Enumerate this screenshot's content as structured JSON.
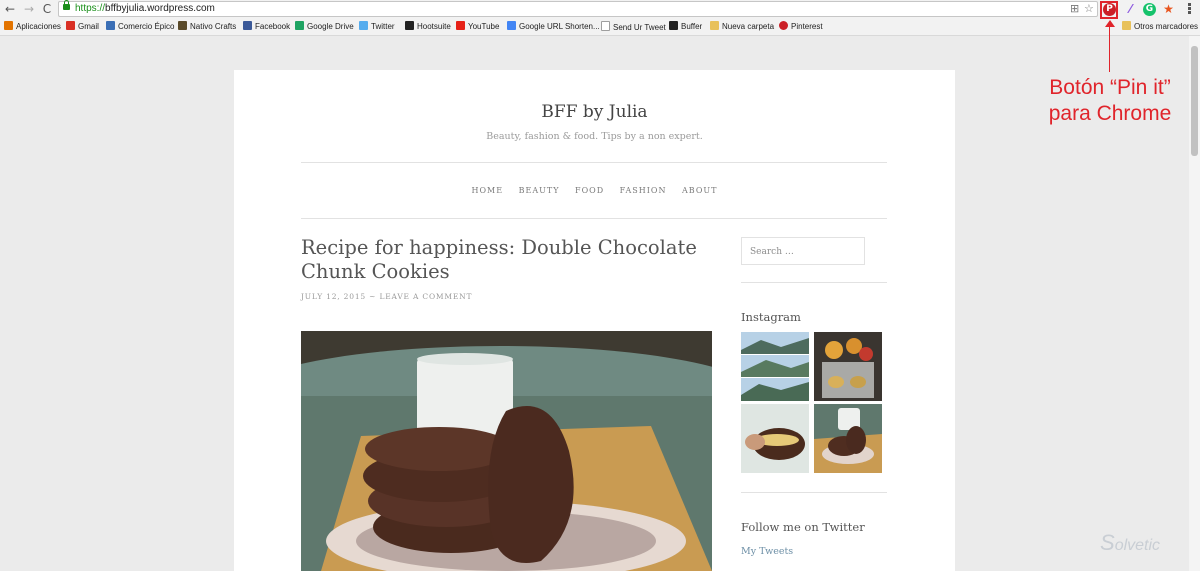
{
  "browser": {
    "url_scheme": "https://",
    "url_host": "bffbyjulia.wordpress.com"
  },
  "bookmarks": [
    {
      "label": "Aplicaciones",
      "icon": "apps-grid-icon",
      "color": "#e37400"
    },
    {
      "label": "Gmail",
      "icon": "gmail-icon",
      "color": "#d93025"
    },
    {
      "label": "Comercio Épico",
      "icon": "comercio-icon",
      "color": "#3b6fb6"
    },
    {
      "label": "Nativo Crafts",
      "icon": "nativo-icon",
      "color": "#5a4a2a"
    },
    {
      "label": "Facebook",
      "icon": "facebook-icon",
      "color": "#3b5998"
    },
    {
      "label": "Google Drive",
      "icon": "drive-icon",
      "color": "#1fa463"
    },
    {
      "label": "Twitter",
      "icon": "twitter-icon",
      "color": "#55acee"
    },
    {
      "label": "Hootsuite",
      "icon": "hootsuite-icon",
      "color": "#222222"
    },
    {
      "label": "YouTube",
      "icon": "youtube-icon",
      "color": "#e62117"
    },
    {
      "label": "Google URL Shorten...",
      "icon": "google-icon",
      "color": "#4285f4"
    },
    {
      "label": "Send Ur Tweet",
      "icon": "page-icon",
      "color": "#9e9e9e"
    },
    {
      "label": "Buffer",
      "icon": "buffer-icon",
      "color": "#222222"
    },
    {
      "label": "Nueva carpeta",
      "icon": "folder-icon",
      "color": "#e8c15b"
    },
    {
      "label": "Pinterest",
      "icon": "pinterest-icon",
      "color": "#cb2027"
    }
  ],
  "other_bookmarks": "Otros marcadores",
  "site": {
    "title": "BFF by Julia",
    "tagline": "Beauty, fashion & food. Tips by a non expert.",
    "menu": [
      "HOME",
      "BEAUTY",
      "FOOD",
      "FASHION",
      "ABOUT"
    ]
  },
  "post": {
    "title": "Recipe for happiness: Double Chocolate Chunk Cookies",
    "date": "JULY 12, 2015",
    "separator": "~",
    "comment_link": "LEAVE A COMMENT"
  },
  "sidebar": {
    "search_placeholder": "Search …",
    "instagram_title": "Instagram",
    "twitter_title": "Follow me on Twitter",
    "twitter_link": "My Tweets"
  },
  "annotation": {
    "line1": "Botón “Pin it”",
    "line2": "para Chrome"
  },
  "watermark": "olvetic",
  "colors": {
    "annotation_red": "#e0242b",
    "pinterest_red": "#cb2027",
    "link_blue": "#6d8fa6"
  }
}
